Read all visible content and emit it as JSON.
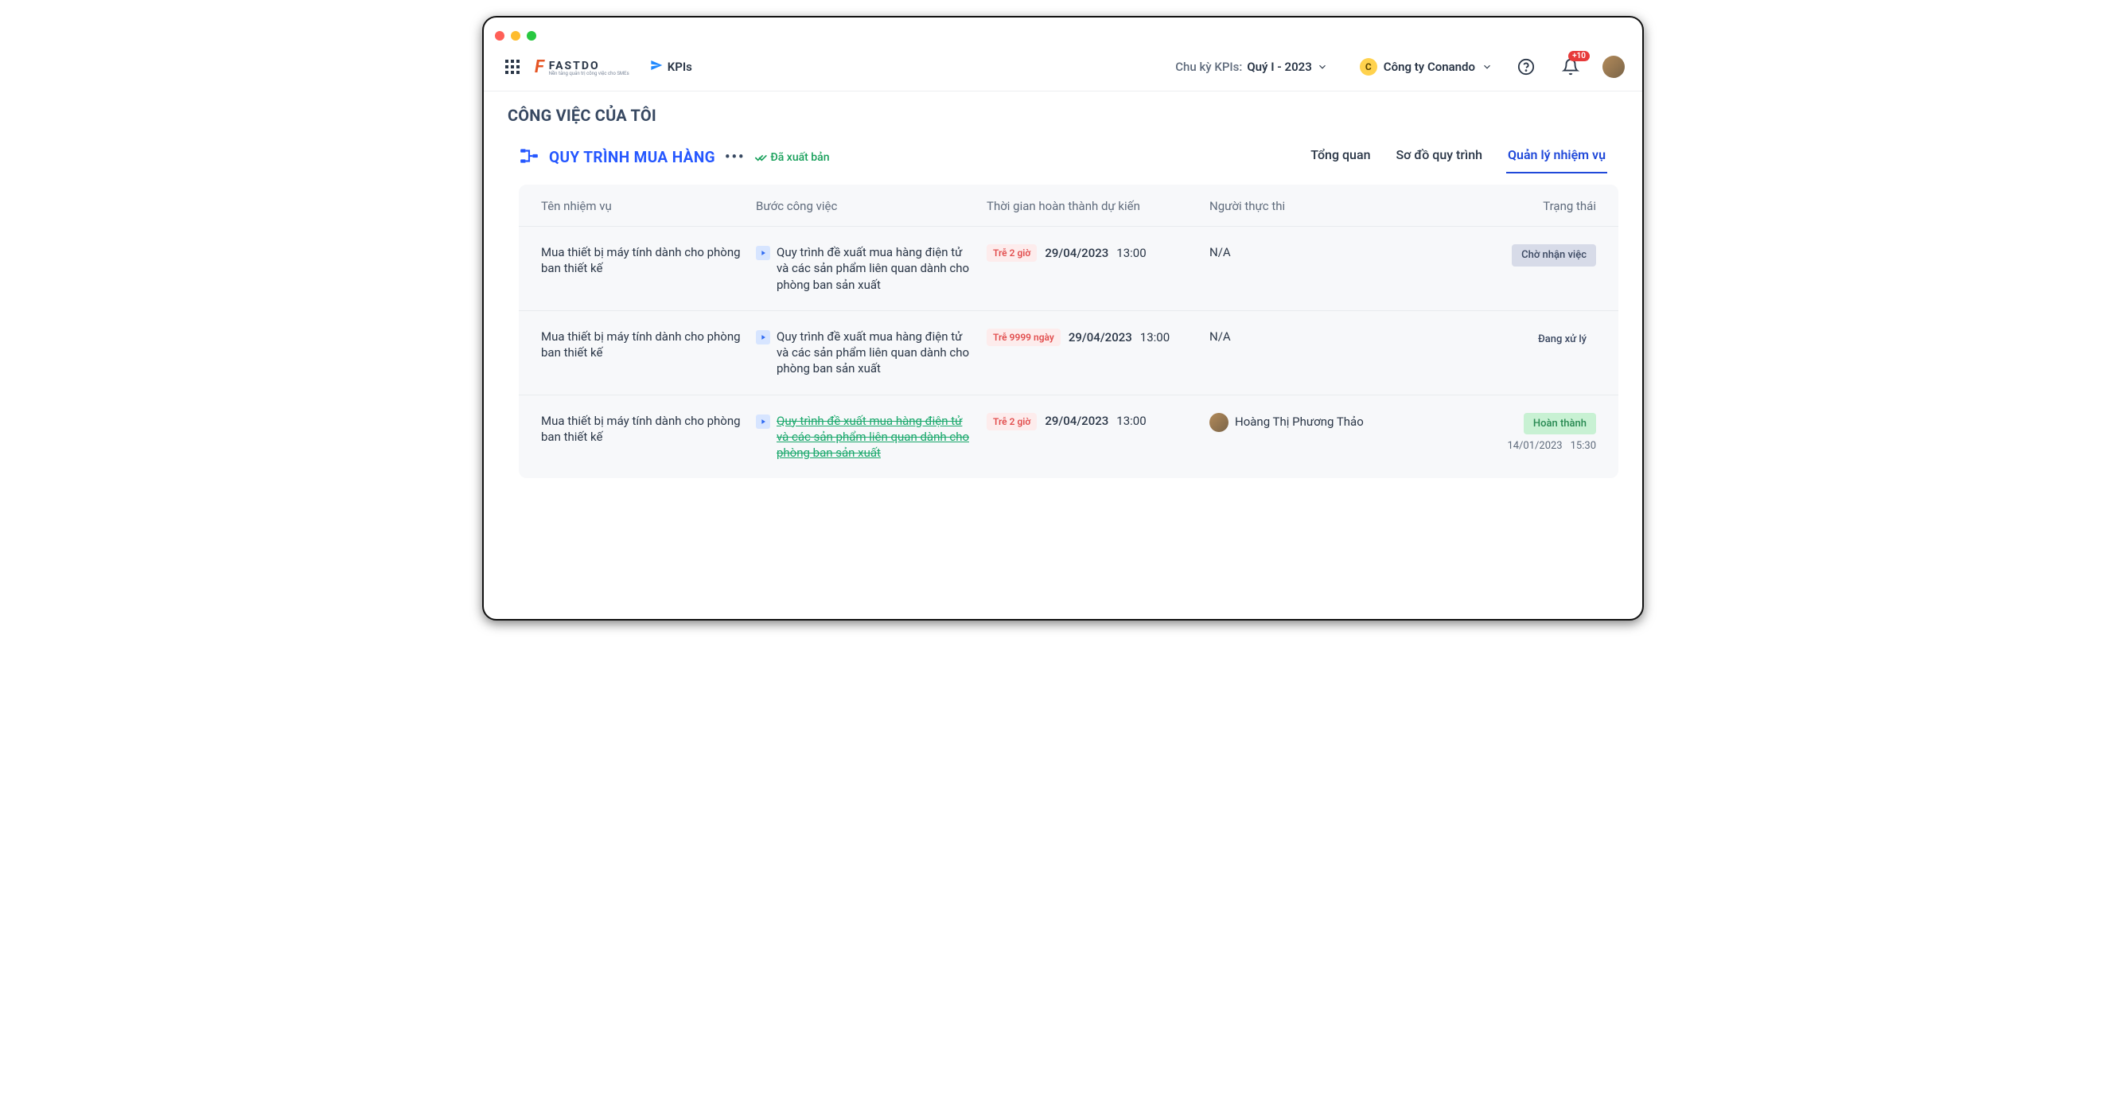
{
  "brand": {
    "name": "FASTDO",
    "tagline": "Nền tảng quản trị công việc cho SMEs"
  },
  "kpi_label": "KPIs",
  "cycle": {
    "label": "Chu kỳ KPIs:",
    "value": "Quý I - 2023"
  },
  "company": {
    "initial": "C",
    "name": "Công ty Conando"
  },
  "notification_badge": "+10",
  "page_title": "CÔNG VIỆC CỦA TÔI",
  "process": {
    "title": "QUY TRÌNH MUA HÀNG",
    "publish_label": "Đã xuất bản"
  },
  "tabs": [
    {
      "label": "Tổng quan",
      "active": false
    },
    {
      "label": "Sơ đồ quy trình",
      "active": false
    },
    {
      "label": "Quản lý nhiệm vụ",
      "active": true
    }
  ],
  "columns": {
    "name": "Tên nhiệm vụ",
    "step": "Bước công việc",
    "time": "Thời gian hoàn thành dự kiến",
    "executor": "Người thực thi",
    "status": "Trạng thái"
  },
  "tasks": [
    {
      "name": "Mua thiết bị máy tính dành cho phòng ban thiết kế",
      "step": "Quy trình đề xuất mua hàng điện tử và các sản phẩm liên quan dành cho phòng ban sản xuất",
      "late": "Trễ 2 giờ",
      "date": "29/04/2023",
      "time": "13:00",
      "executor_name": "N/A",
      "executor_avatar": false,
      "step_done": false,
      "status_label": "Chờ nhận việc",
      "status_class": "status-waiting",
      "completed_date": "",
      "completed_time": ""
    },
    {
      "name": "Mua thiết bị máy tính dành cho phòng ban thiết kế",
      "step": "Quy trình đề xuất mua hàng điện tử và các sản phẩm liên quan dành cho phòng ban sản xuất",
      "late": "Trễ 9999 ngày",
      "date": "29/04/2023",
      "time": "13:00",
      "executor_name": "N/A",
      "executor_avatar": false,
      "step_done": false,
      "status_label": "Đang xử lý",
      "status_class": "status-processing",
      "completed_date": "",
      "completed_time": ""
    },
    {
      "name": "Mua thiết bị máy tính dành cho phòng ban thiết kế",
      "step": "Quy trình đề xuất mua hàng điện tử và các sản phẩm liên quan dành cho phòng ban sản xuất",
      "late": "Trễ 2 giờ",
      "date": "29/04/2023",
      "time": "13:00",
      "executor_name": "Hoàng Thị Phương Thảo",
      "executor_avatar": true,
      "step_done": true,
      "status_label": "Hoàn thành",
      "status_class": "status-done",
      "completed_date": "14/01/2023",
      "completed_time": "15:30"
    }
  ]
}
